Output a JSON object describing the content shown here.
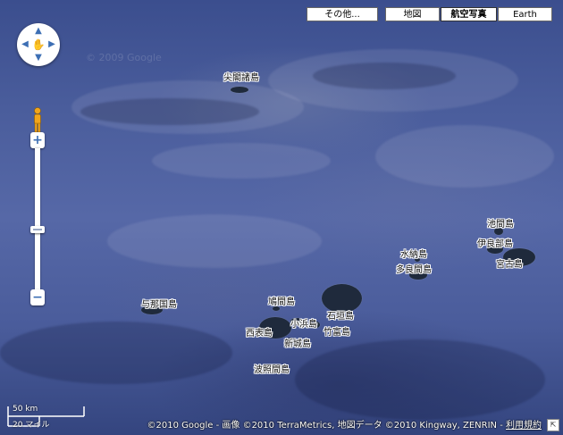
{
  "map_types": {
    "other": "その他...",
    "map": "地図",
    "satellite": "航空写真",
    "earth": "Earth"
  },
  "watermark": "© 2009 Google",
  "labels": {
    "senkaku": "尖閣諸島",
    "ikema": "池間島",
    "irabu": "伊良部島",
    "miyako": "宮古島",
    "minna": "水納島",
    "tarama": "多良間島",
    "yonaguni": "与那国島",
    "hatoma": "鳩間島",
    "ishigaki": "石垣島",
    "kohama": "小浜島",
    "taketomi": "竹富島",
    "iriomote": "西表島",
    "aragusuku": "新城島",
    "hateruma": "波照間島"
  },
  "scale": {
    "km": "50 km",
    "mile": "20 マイル"
  },
  "copyright": {
    "text": "©2010 Google - 画像 ©2010 TerraMetrics, 地図データ ©2010 Kingway, ZENRIN - ",
    "terms": "利用規約"
  },
  "icons": {
    "pan": "pan-control-icon",
    "pegman": "pegman-icon",
    "corner": "overview-toggle-icon"
  }
}
